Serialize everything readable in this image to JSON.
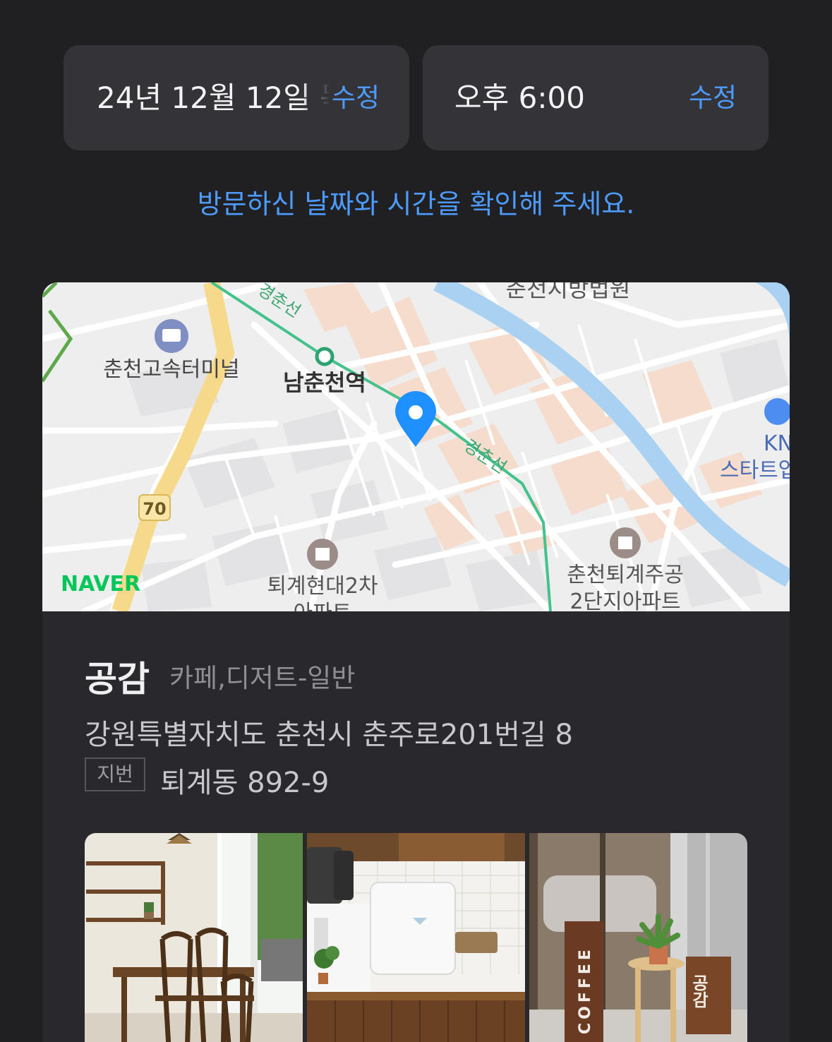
{
  "date_chip": {
    "value": "24년 12월 12일 목",
    "edit_label": "수정"
  },
  "time_chip": {
    "value": "오후 6:00",
    "edit_label": "수정"
  },
  "notice": "방문하신 날짜와 시간을 확인해 주세요.",
  "map": {
    "brand": "NAVER",
    "route_number": "70",
    "labels": {
      "court": "춘천지방법원",
      "rail_line_1": "경춘선",
      "rail_line_2": "경춘선",
      "bus_terminal": "춘천고속터미널",
      "station": "남춘천역",
      "school_1": "KN",
      "school_2": "스타트업",
      "apartment_1_line1": "퇴계현대2차",
      "apartment_1_line2": "아파트",
      "apartment_2_line1": "춘천퇴계주공",
      "apartment_2_line2": "2단지아파트"
    }
  },
  "place": {
    "name": "공감",
    "category": "카페,디저트-일반",
    "address": "강원특별자치도 춘천시 춘주로201번길 8",
    "jibun_label": "지번",
    "jibun_address": "퇴계동 892-9"
  },
  "photos": {
    "sign_coffee": "COFFEE",
    "sign_name": "공감"
  },
  "colors": {
    "background": "#202023",
    "chip": "#343438",
    "accent": "#4d9bff",
    "card": "#29292d",
    "naver_green": "#03c75a",
    "map_pin": "#1e90ff"
  }
}
